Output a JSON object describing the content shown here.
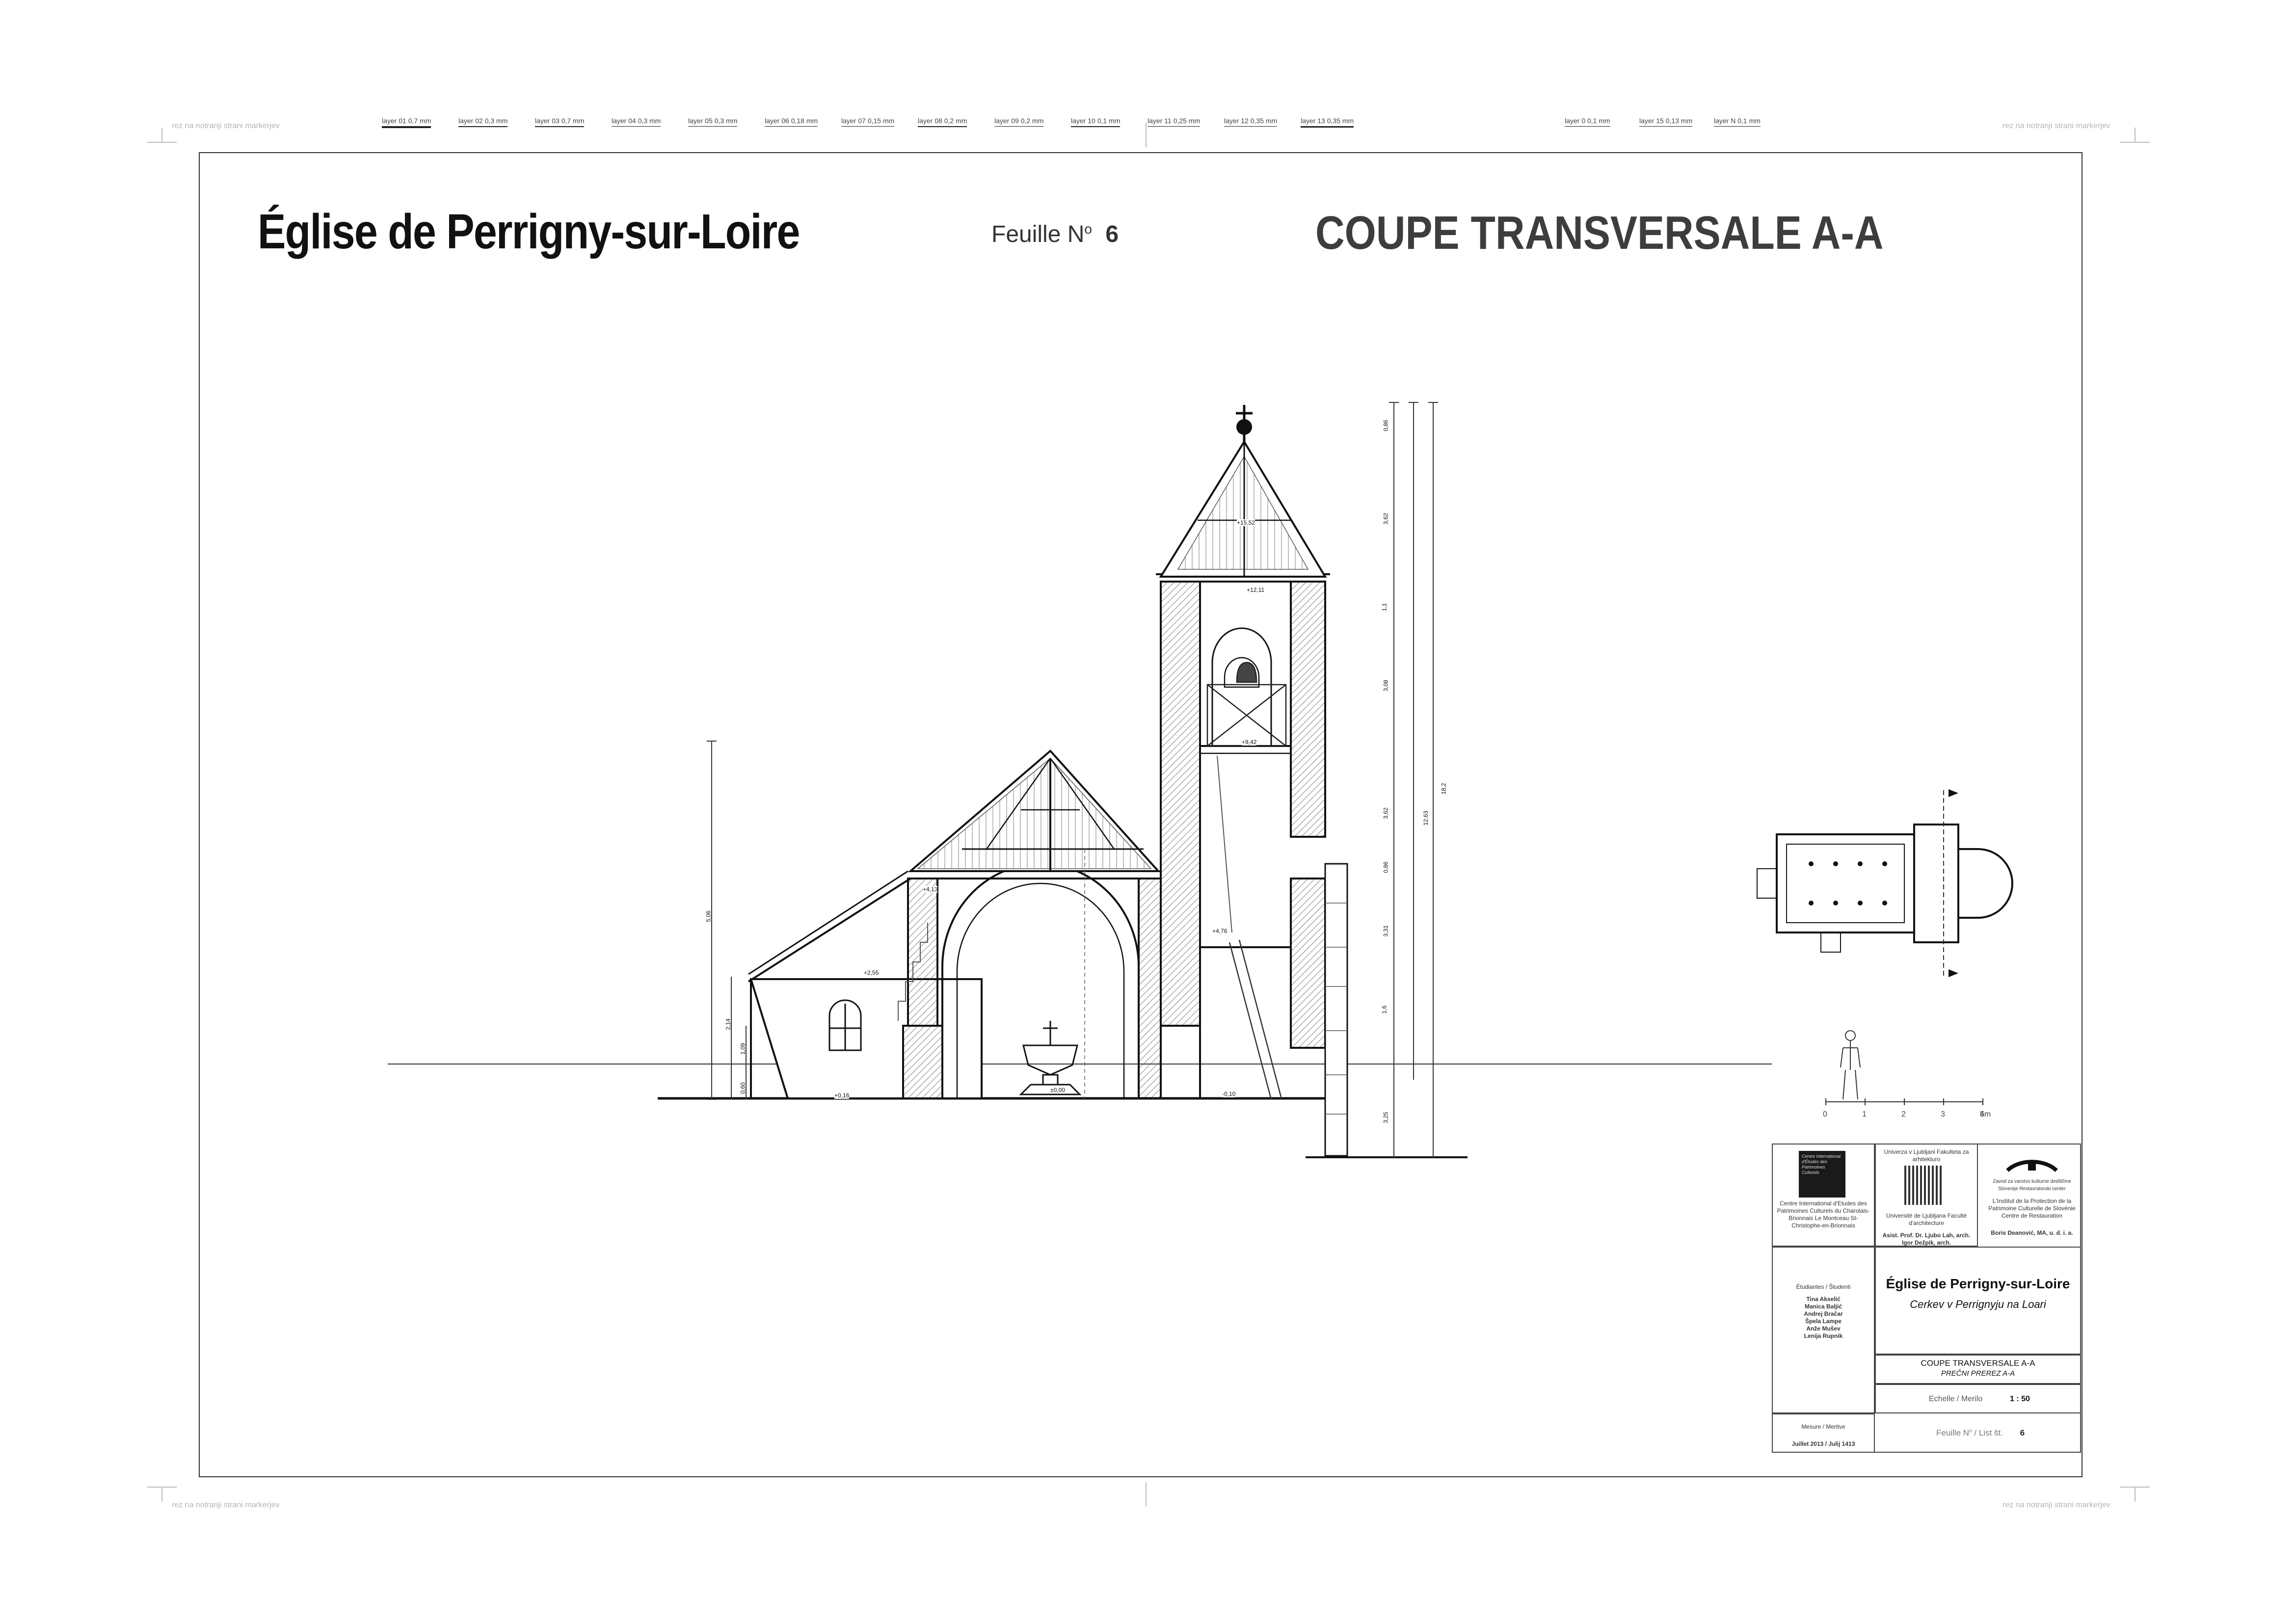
{
  "corner_text": {
    "top_left": "rez na notranji strani markerjev",
    "top_right": "rez na notranji strani markerjev",
    "bottom_left": "rez na notranji strani markerjev",
    "bottom_right": "rez na notranji strani markerjev"
  },
  "layers_left": [
    {
      "label": "layer 01  0,7 mm",
      "w": 4
    },
    {
      "label": "layer 02  0,3 mm",
      "w": 2
    },
    {
      "label": "layer 03  0,7 mm",
      "w": 2
    },
    {
      "label": "layer 04  0,3 mm",
      "w": 1
    },
    {
      "label": "layer 05  0,3 mm",
      "w": 1
    },
    {
      "label": "layer 06  0,18 mm",
      "w": 1
    },
    {
      "label": "layer 07  0,15 mm",
      "w": 1
    },
    {
      "label": "layer 08  0,2 mm",
      "w": 2
    },
    {
      "label": "layer 09  0,2 mm",
      "w": 1
    },
    {
      "label": "layer 10  0,1 mm",
      "w": 2
    },
    {
      "label": "layer 11  0,25 mm",
      "w": 1
    },
    {
      "label": "layer 12  0,35 mm",
      "w": 1
    },
    {
      "label": "layer 13  0,35 mm",
      "w": 3
    }
  ],
  "layers_right": [
    {
      "label": "layer 0  0,1 mm",
      "w": 1
    },
    {
      "label": "layer 15  0,13 mm",
      "w": 1
    },
    {
      "label": "layer N  0,1 mm",
      "w": 1
    }
  ],
  "header": {
    "church_title": "Église de Perrigny-sur-Loire",
    "sheet_label": "Feuille N",
    "sheet_sup": "o",
    "sheet_number": "6",
    "drawing_title": "COUPE TRANSVERSALE A-A"
  },
  "dimensions": {
    "left_total": "5,06",
    "left_a": "2,14",
    "left_b": "1,09",
    "left_c": "0,60",
    "right_total": "18,2",
    "right_mid": "12,63",
    "right_segments": [
      "0,86",
      "3,62",
      "1,1",
      "3,08",
      "3,62",
      "0,86",
      "3,31",
      "1,6",
      "3,25"
    ],
    "levels": [
      "+4,13",
      "+4,76",
      "+2,55",
      "±0,00",
      "+0,16",
      "-0,10",
      "+9,42",
      "+12,11",
      "+15,52"
    ]
  },
  "scale_bar": {
    "ticks": [
      "0",
      "1",
      "2",
      "3",
      "4",
      "5m"
    ]
  },
  "title_block": {
    "logo1_text": "Centre International d'Études des Patrimoines Culturels",
    "logo1_address": "Centre International d'Etudes des Patrimoines Culturels du Charolais-Brionnais Le Montceau St-Christophe-en-Brionnais",
    "logo2_header": "Univerza v Ljubljani Fakulteta za arhitekturo",
    "logo2_name": "Université de Ljubljana Faculté d'architecture",
    "logo2_people": "Asist. Prof. Dr. Ljubo Lah, arch. Igor Dežpik, arch.",
    "logo3_header": "Zavod za varstvo kulturne dediščine Slovenije Restavratorski center",
    "logo3_name": "L'Institut de la Protection de la Patrimoine Culturelle de Slovénie Centre de Restauration",
    "logo3_people": "Boris Deanović, MA, u. d. i. a.",
    "students_label": "Étudiantes / Študenti",
    "students": [
      "Tina Akselić",
      "Manica Baljić",
      "Andrej Bračar",
      "Špela Lampe",
      "Anže Mušev",
      "Lenija Rupnik"
    ],
    "church_title": "Église de Perrigny-sur-Loire",
    "church_subtitle": "Cerkev v Perrignyju na Loari",
    "drawing_fr": "COUPE TRANSVERSALE A-A",
    "drawing_sl": "PREČNI PREREZ A-A",
    "scale_label": "Echelle / Merilo",
    "scale_value": "1 : 50",
    "survey_label": "Mesure / Meritve",
    "survey_date": "Juillet 2013 / Julij 1413",
    "sheet_label": "Feuille N",
    "sheet_label_sl": "/ List št.",
    "sheet_number": "6"
  }
}
